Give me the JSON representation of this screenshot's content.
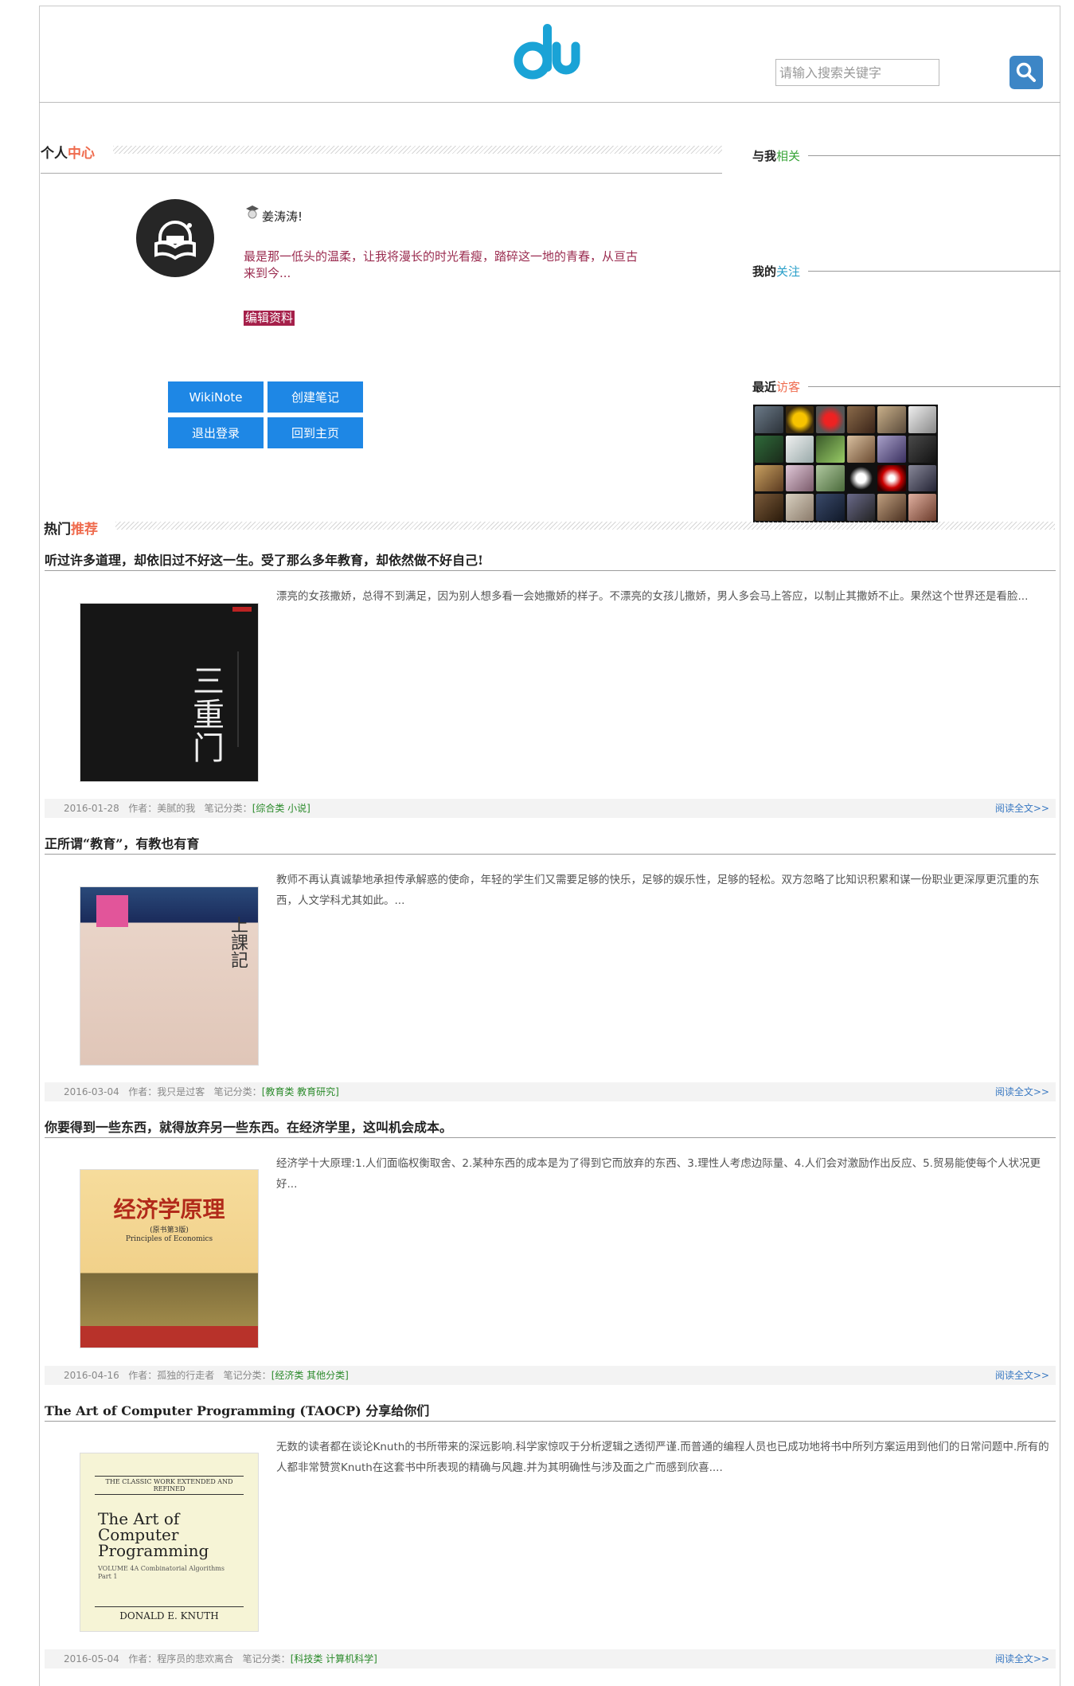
{
  "header": {
    "search_placeholder": "请输入搜索关键字",
    "logo_icon": "du-logo-icon",
    "search_icon": "search-icon"
  },
  "profile": {
    "title_a": "个人",
    "title_b": "中心",
    "greeting": "姜涛涛!",
    "motto": "最是那一低头的温柔，让我将漫长的时光看瘦，踏碎这一地的青春，从亘古来到今...",
    "edit_label": "编辑资料",
    "buttons": [
      "WikiNote",
      "创建笔记",
      "退出登录",
      "回到主页"
    ]
  },
  "sidebar": {
    "related_a": "与我",
    "related_b": "相关",
    "follow_a": "我的",
    "follow_b": "关注",
    "visitors_a": "最近",
    "visitors_b": "访客"
  },
  "hot": {
    "title_a": "热门",
    "title_b": "推荐",
    "read_more": "阅读全文>>",
    "articles": [
      {
        "title": "听过许多道理，却依旧过不好这一生。受了那么多年教育，却依然做不好自己!",
        "excerpt": "漂亮的女孩撒娇，总得不到满足，因为别人想多看一会她撒娇的样子。不漂亮的女孩儿撒娇，男人多会马上答应，以制止其撒娇不止。果然这个世界还是看脸...",
        "date": "2016-01-28",
        "author": "作者：美腻的我",
        "category_label": "笔记分类：",
        "category": "[综合类 小说]",
        "cover_text": "三重门"
      },
      {
        "title": "正所谓“教育”，有教也有育",
        "excerpt": "教师不再认真诚挚地承担传承解惑的使命，年轻的学生们又需要足够的快乐，足够的娱乐性，足够的轻松。双方忽略了比知识积累和谋一份职业更深厚更沉重的东西，人文学科尤其如此。...",
        "date": "2016-03-04",
        "author": "作者：我只是过客",
        "category_label": "笔记分类：",
        "category": "[教育类 教育研究]",
        "cover_text": "上課記"
      },
      {
        "title": "你要得到一些东西，就得放弃另一些东西。在经济学里，这叫机会成本。",
        "excerpt": "经济学十大原理:1.人们面临权衡取舍、2.某种东西的成本是为了得到它而放弃的东西、3.理性人考虑边际量、4.人们会对激励作出反应、5.贸易能使每个人状况更好...",
        "date": "2016-04-16",
        "author": "作者：孤独的行走者",
        "category_label": "笔记分类：",
        "category": "[经济类 其他分类]",
        "cover_text": "经济学原理",
        "cover_sub": "(原书第3版)",
        "cover_en": "Principles of Economics"
      },
      {
        "title": "The Art of Computer Programming (TAOCP) 分享给你们",
        "excerpt": "无数的读者都在谈论Knuth的书所带来的深远影响.科学家惊叹于分析逻辑之透彻严谨.而普通的编程人员也已成功地将书中所列方案运用到他们的日常问题中.所有的人都非常赞赏Knuth在这套书中所表现的精确与风趣.并为其明确性与涉及面之广而感到欣喜....",
        "date": "2016-05-04",
        "author": "作者：程序员的悲欢离合",
        "category_label": "笔记分类：",
        "category": "[科技类 计算机科学]",
        "cover_text": "The Art of Computer Programming",
        "cover_top": "THE CLASSIC WORK EXTENDED AND REFINED",
        "cover_vol": "VOLUME 4A Combinatorial Algorithms Part 1",
        "cover_author": "DONALD E. KNUTH"
      }
    ]
  },
  "colors": {
    "accent": "#1e87e5",
    "brand": "#1aa3d6",
    "highlight": "#ef6b4e",
    "motto": "#9a2b4f",
    "edit_bg": "#a5204a"
  }
}
